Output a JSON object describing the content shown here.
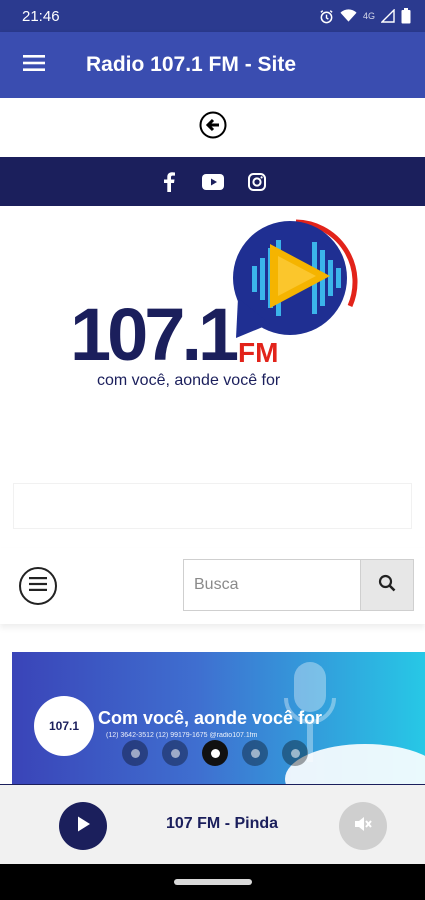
{
  "status_bar": {
    "time": "21:46",
    "network": "4G",
    "icons": [
      "alarm-icon",
      "wifi-icon",
      "signal-icon",
      "battery-icon"
    ]
  },
  "app_bar": {
    "title": "Radio 107.1 FM - Site",
    "menu_icon": "hamburger-menu-icon"
  },
  "back_row": {
    "icon": "back-arrow-icon"
  },
  "social": {
    "items": [
      "facebook-icon",
      "youtube-icon",
      "instagram-icon"
    ]
  },
  "logo": {
    "number": "107.1",
    "suffix": "FM",
    "tagline": "com você, aonde você for"
  },
  "search": {
    "placeholder": "Busca",
    "button_icon": "search-icon",
    "menu_icon": "circle-menu-icon"
  },
  "banner": {
    "logo_text": "107.1",
    "headline": "Com você, aonde você for",
    "contacts": "(12) 3642-3512   (12) 99179-1675   @radio107.1fm",
    "slide_count": 5,
    "active_slide": 3
  },
  "player": {
    "station": "107 FM - Pinda",
    "play_icon": "play-icon",
    "mute_icon": "volume-mute-icon"
  },
  "colors": {
    "app_bar": "#3a4db0",
    "status_bar": "#2b3a8f",
    "navy": "#1b1f5c",
    "accent_red": "#e2231a",
    "logo_yellow": "#f5b400"
  }
}
